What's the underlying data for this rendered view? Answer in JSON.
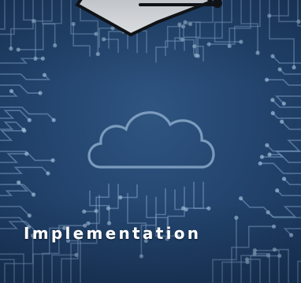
{
  "card": {
    "title": "Implementation",
    "background_image": "circuit-board-pattern",
    "top_icon": "graduation-cap-icon",
    "center_icon": "cloud-icon",
    "colors": {
      "background": "#244670",
      "trace": "#7fa3c9",
      "title_text": "#ffffff"
    }
  }
}
